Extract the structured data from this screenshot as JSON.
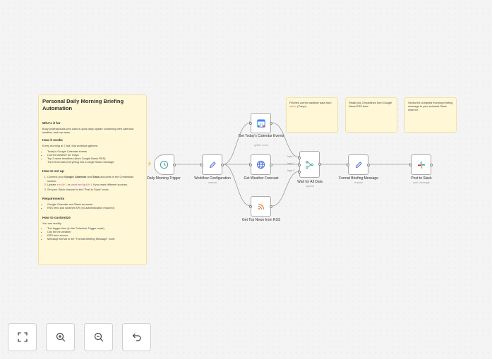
{
  "sticky_main": {
    "title": "Personal Daily Morning Briefing Automation",
    "who_heading": "Who's it for",
    "who_text": "Busy professionals who want a quick daily update combining their calendar, weather, and top news.",
    "how_heading": "How it works",
    "how_text": "Every morning at 7 AM, this workflow gathers:",
    "how_items": [
      "Today's Google Calendar events",
      "Current weather for Tokyo",
      "Top 3 news headlines (from Google News RSS)",
      "Then it formats everything into a single Slack message."
    ],
    "setup_heading": "How to set up",
    "setup_1a": "Connect your ",
    "setup_1b": "Google Calendar",
    "setup_1c": " and ",
    "setup_1d": "Slack",
    "setup_1e": " accounts in the Credentials section.",
    "setup_2a": "Update ",
    "setup_2b": "rssUrl",
    "setup_2c": " or ",
    "setup_2d": "weatherApiUrl",
    "setup_2e": " if you want different sources.",
    "setup_3": "Set your Slack channel in the \"Post to Slack\" node.",
    "req_heading": "Requirements",
    "req_items": [
      "Google Calendar and Slack accounts",
      "RSS feed and weather API (no authentication required)"
    ],
    "custom_heading": "How to customize",
    "custom_text": "You can modify:",
    "custom_items": [
      "The trigger time (in the Schedule Trigger node)",
      "City for the weather",
      "RSS feed source",
      "Message format in the \"Format Briefing Message\" node"
    ]
  },
  "sticky_weather": {
    "text_a": "Fetches current weather data from ",
    "text_b": "wttr.in",
    "text_c": " (Tokyo)."
  },
  "sticky_rss": {
    "text": "Reads top 3 headlines from Google News RSS feed."
  },
  "sticky_slack": {
    "text": "Sends the compiled morning briefing message to your selected Slack channel."
  },
  "nodes": {
    "trigger": {
      "label": "Daily Morning Trigger"
    },
    "config": {
      "label": "Workflow Configuration",
      "sub": "manual"
    },
    "calendar": {
      "label": "Get Today's Calendar Events",
      "sub": "getAll: event"
    },
    "weather": {
      "label": "Get Weather Forecast"
    },
    "rss": {
      "label": "Get Top News from RSS"
    },
    "merge": {
      "label": "Wait for All Data",
      "sub": "append",
      "inputs": [
        "Input 1",
        "Input 2",
        "Input 3"
      ]
    },
    "format": {
      "label": "Format Briefing Message",
      "sub": "manual"
    },
    "slack": {
      "label": "Post to Slack",
      "sub": "post: message"
    }
  },
  "colors": {
    "sticky_bg": "#fff7d6",
    "accent_orange": "#e2722a",
    "node_border": "#aaaaaa"
  },
  "icons": {
    "trigger": "clock-icon",
    "config": "pencil-icon",
    "calendar": "google-calendar-icon",
    "weather": "globe-icon",
    "rss": "rss-icon",
    "merge": "merge-icon",
    "format": "pencil-icon",
    "slack": "slack-icon"
  },
  "controls": [
    "fit-view-icon",
    "zoom-in-icon",
    "zoom-out-icon",
    "undo-icon"
  ]
}
